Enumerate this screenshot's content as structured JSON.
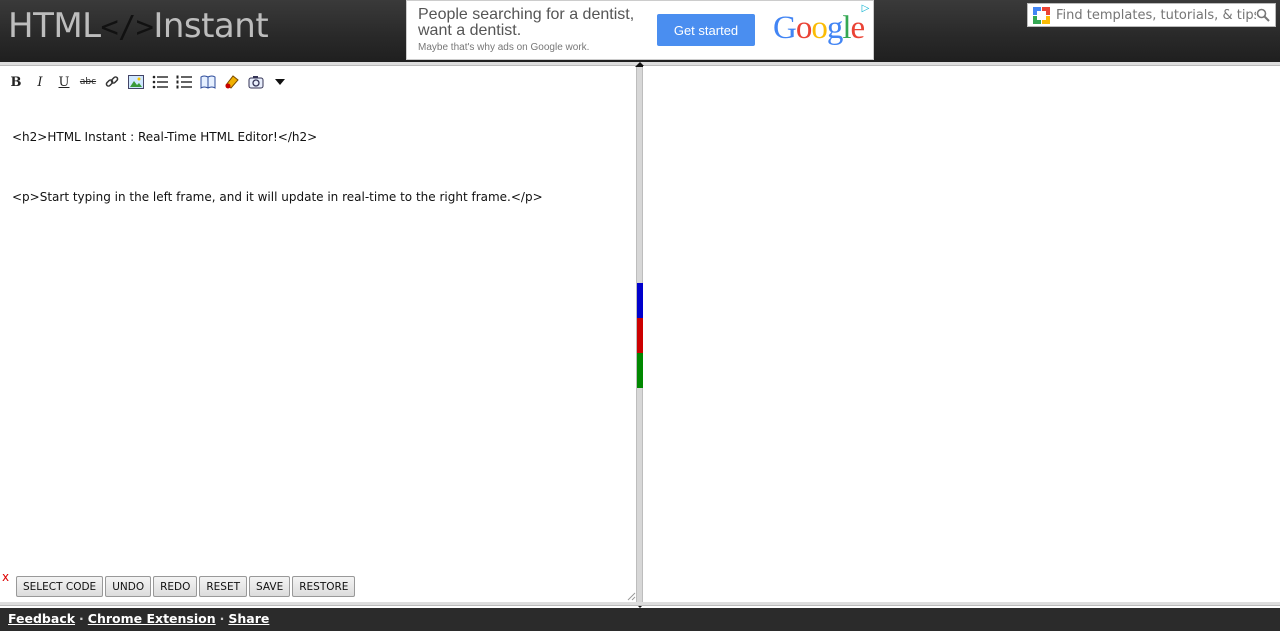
{
  "logo": {
    "part1": "HTML",
    "tag": "</>",
    "part2": "Instant"
  },
  "ad": {
    "line1": "People searching for a dentist,",
    "line2": "want a dentist.",
    "line3": "Maybe that's why ads on Google work.",
    "button": "Get started",
    "brand_letters": [
      "G",
      "o",
      "o",
      "g",
      "l",
      "e"
    ],
    "choice_icon": "▷"
  },
  "search": {
    "placeholder": "Find templates, tutorials, & tips"
  },
  "toolbar": {
    "bold": "B",
    "italic": "I",
    "underline": "U",
    "strike": "abc"
  },
  "editor": {
    "lines": [
      "<h2>HTML Instant : Real-Time HTML Editor!</h2>",
      "<p>Start typing in the left frame, and it will update in real-time to the right frame.</p>"
    ],
    "clear_mark": "x"
  },
  "buttons": {
    "select_code": "SELECT CODE",
    "undo": "UNDO",
    "redo": "REDO",
    "reset": "RESET",
    "save": "SAVE",
    "restore": "RESTORE"
  },
  "colors": {
    "blue": "#0000cc",
    "red": "#cc0000",
    "green": "#008800"
  },
  "footer": {
    "feedback": "Feedback",
    "chrome_extension": "Chrome Extension",
    "share": "Share",
    "separator": "·"
  }
}
